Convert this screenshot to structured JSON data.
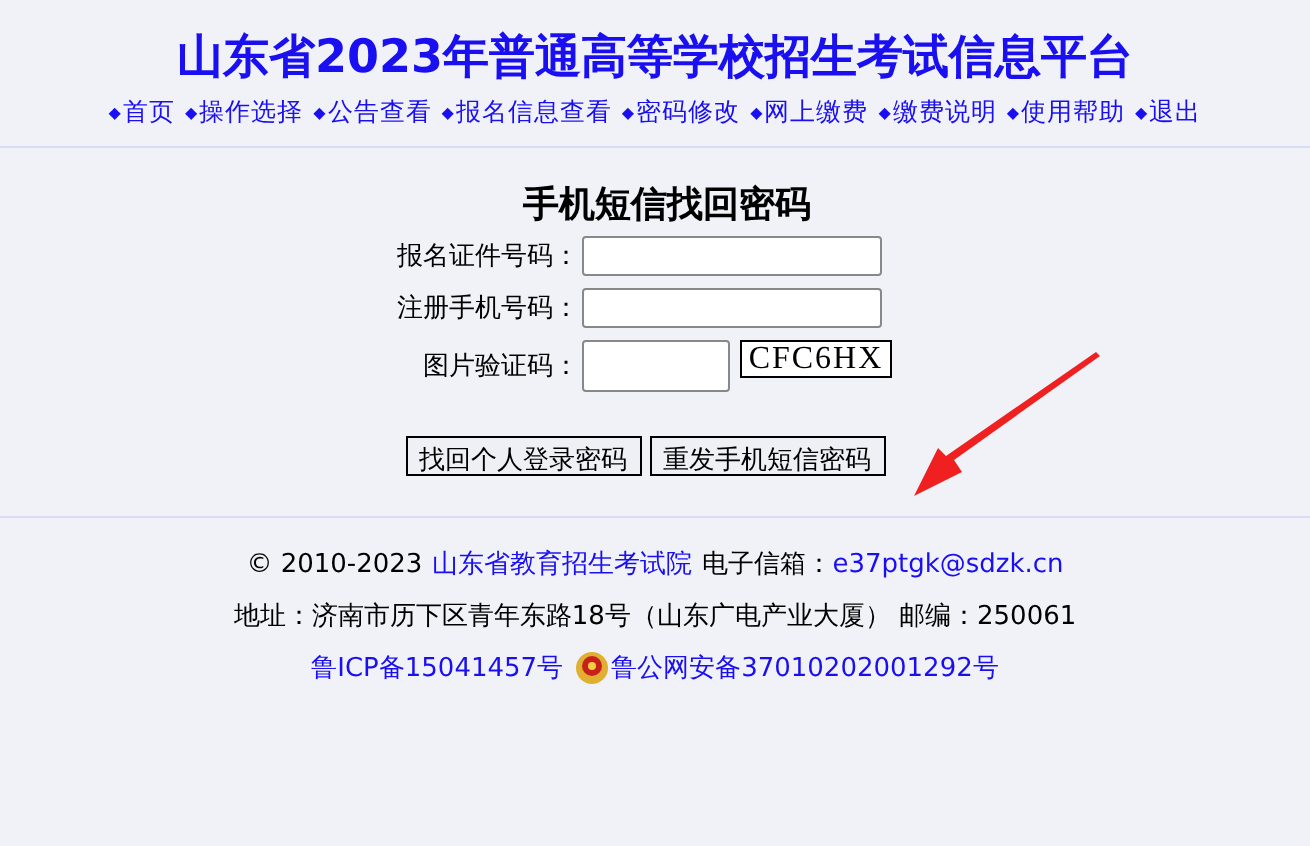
{
  "header": {
    "title": "山东省2023年普通高等学校招生考试信息平台",
    "nav": [
      {
        "label": "首页"
      },
      {
        "label": "操作选择"
      },
      {
        "label": "公告查看"
      },
      {
        "label": "报名信息查看"
      },
      {
        "label": "密码修改"
      },
      {
        "label": "网上缴费"
      },
      {
        "label": "缴费说明"
      },
      {
        "label": "使用帮助"
      },
      {
        "label": "退出"
      }
    ],
    "bullet": "◆"
  },
  "form": {
    "title": "手机短信找回密码",
    "fields": [
      {
        "label": "报名证件号码：",
        "kind": "wide"
      },
      {
        "label": "注册手机号码：",
        "kind": "wide"
      },
      {
        "label": "图片验证码：",
        "kind": "captcha",
        "captcha": "CFC6HX"
      }
    ],
    "buttons": [
      "找回个人登录密码",
      "重发手机短信密码"
    ]
  },
  "footer": {
    "copyright": "© 2010-2023",
    "org": "山东省教育招生考试院",
    "email_label": "电子信箱：",
    "email": "e37ptgk@sdzk.cn",
    "address": "地址：济南市历下区青年东路18号（山东广电产业大厦） 邮编：250061",
    "icp": "鲁ICP备15041457号",
    "police": "鲁公网安备37010202001292号"
  }
}
